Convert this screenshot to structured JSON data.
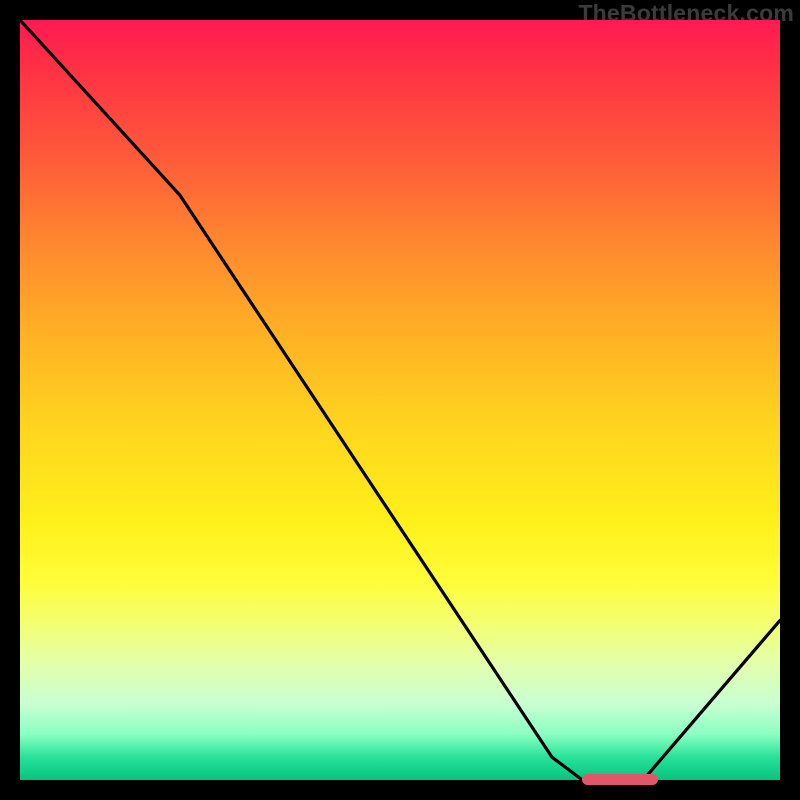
{
  "watermark": "TheBottleneck.com",
  "chart_data": {
    "type": "line",
    "title": "",
    "xlabel": "",
    "ylabel": "",
    "xlim": [
      0,
      100
    ],
    "ylim": [
      0,
      100
    ],
    "x": [
      0,
      21,
      70,
      74,
      82,
      100
    ],
    "values": [
      100,
      77,
      3,
      0,
      0,
      21
    ],
    "optimum_marker": {
      "x_start": 74,
      "x_end": 84,
      "y": 0
    },
    "gradient_stops": [
      {
        "pos": 0,
        "color": "#ff1a53"
      },
      {
        "pos": 7,
        "color": "#ff3344"
      },
      {
        "pos": 18,
        "color": "#ff5a3a"
      },
      {
        "pos": 30,
        "color": "#ff8a2e"
      },
      {
        "pos": 42,
        "color": "#ffb324"
      },
      {
        "pos": 54,
        "color": "#ffd61f"
      },
      {
        "pos": 66,
        "color": "#fff01a"
      },
      {
        "pos": 74,
        "color": "#fffd3a"
      },
      {
        "pos": 80,
        "color": "#f2ff77"
      },
      {
        "pos": 85,
        "color": "#e2ffae"
      },
      {
        "pos": 90,
        "color": "#c8ffd1"
      },
      {
        "pos": 94,
        "color": "#8affc2"
      },
      {
        "pos": 97,
        "color": "#28e29a"
      },
      {
        "pos": 100,
        "color": "#07c37e"
      }
    ]
  },
  "colors": {
    "curve": "#000000",
    "marker": "#e0576a",
    "frame_bg": "#000000"
  }
}
